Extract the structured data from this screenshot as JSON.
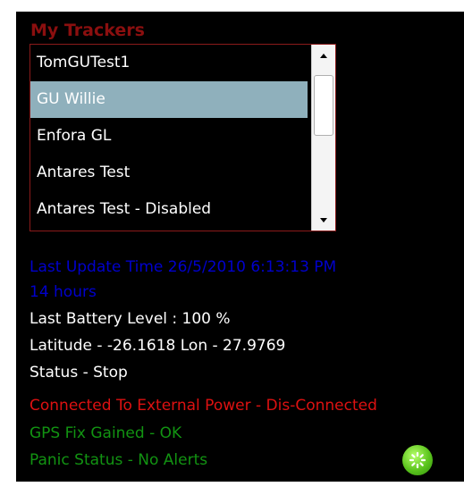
{
  "trackers": {
    "title": "My Trackers",
    "items": [
      {
        "label": "TomGUTest1",
        "selected": false
      },
      {
        "label": "GU Willie",
        "selected": true
      },
      {
        "label": "Enfora GL",
        "selected": false
      },
      {
        "label": "Antares Test",
        "selected": false
      },
      {
        "label": "Antares Test - Disabled",
        "selected": false
      }
    ]
  },
  "details": {
    "last_update": "Last Update Time 26/5/2010 6:13:13 PM",
    "age": "14 hours",
    "battery": "Last Battery Level : 100 %",
    "position": "Latitude - -26.1618 Lon - 27.9769",
    "status": "Status - Stop",
    "power": "Connected To External Power - Dis-Connected",
    "gps": "GPS Fix Gained - OK",
    "panic": "Panic Status - No Alerts"
  },
  "colors": {
    "title": "#8b0f0f",
    "update": "#0000cc",
    "power": "#dd1111",
    "ok": "#129312",
    "selected_row": "#8fb0bc"
  },
  "icons": {
    "refresh": "refresh-icon"
  }
}
